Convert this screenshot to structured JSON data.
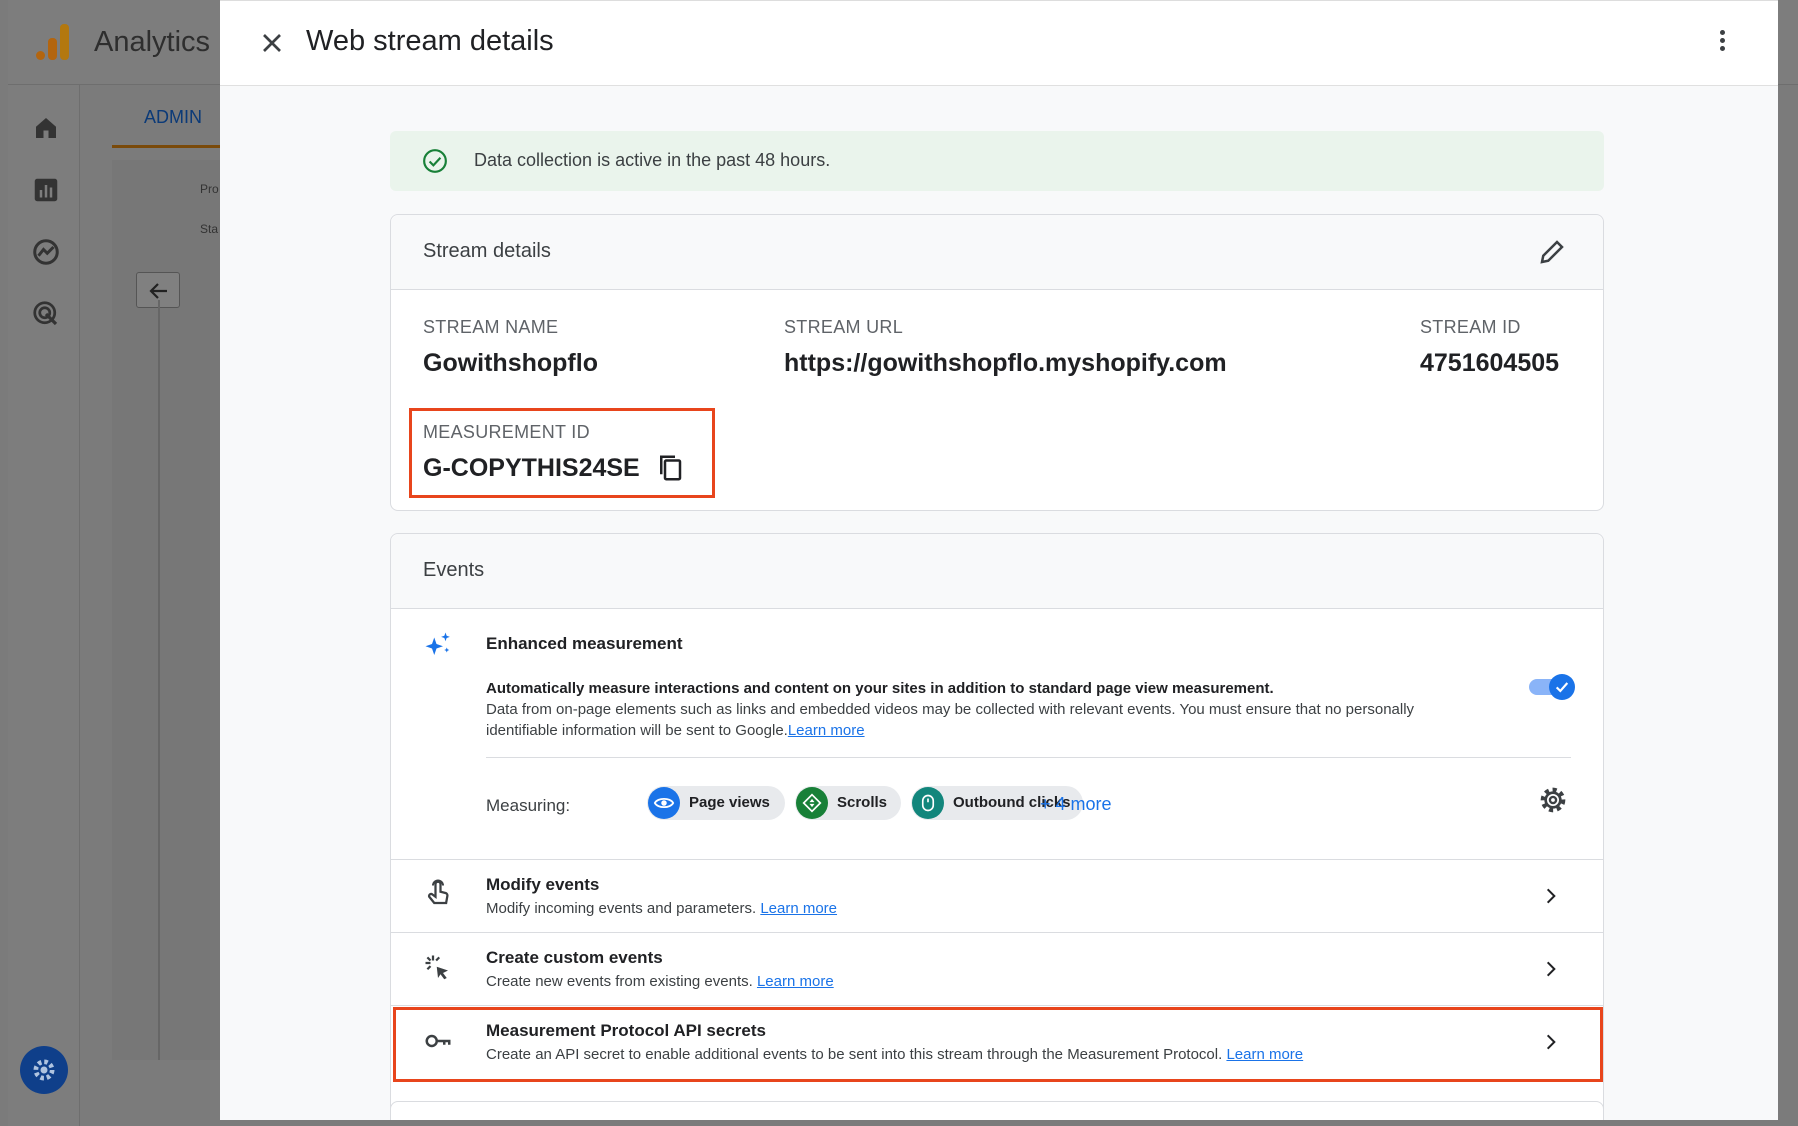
{
  "app": {
    "title": "Analytics",
    "admin_tab": "ADMIN",
    "partial_label_1": "Pro",
    "partial_label_2": "Sta"
  },
  "dialog": {
    "title": "Web stream details"
  },
  "banner": {
    "text": "Data collection is active in the past 48 hours."
  },
  "stream_details": {
    "heading": "Stream details",
    "stream_name_label": "STREAM NAME",
    "stream_name": "Gowithshopflo",
    "stream_url_label": "STREAM URL",
    "stream_url": "https://gowithshopflo.myshopify.com",
    "stream_id_label": "STREAM ID",
    "stream_id": "4751604505",
    "measurement_id_label": "MEASUREMENT ID",
    "measurement_id": "G-COPYTHIS24SE"
  },
  "events": {
    "heading": "Events",
    "enhanced": {
      "title": "Enhanced measurement",
      "desc_line1": "Automatically measure interactions and content on your sites in addition to standard page view measurement.",
      "desc_line2": "Data from on-page elements such as links and embedded videos may be collected with relevant events. You must ensure that no personally identifiable information will be sent to Google.",
      "learn_more": "Learn more",
      "enabled": true
    },
    "measuring_label": "Measuring:",
    "chips": [
      {
        "label": "Page views",
        "color": "#1a73e8"
      },
      {
        "label": "Scrolls",
        "color": "#188038"
      },
      {
        "label": "Outbound clicks",
        "color": "#12867c"
      }
    ],
    "more": "+ 4 more",
    "rows": [
      {
        "title": "Modify events",
        "desc": "Modify incoming events and parameters.",
        "link": "Learn more"
      },
      {
        "title": "Create custom events",
        "desc": "Create new events from existing events.",
        "link": "Learn more"
      },
      {
        "title": "Measurement Protocol API secrets",
        "desc": "Create an API secret to enable additional events to be sent into this stream through the Measurement Protocol.",
        "link": "Learn more"
      }
    ]
  },
  "colors": {
    "accent": "#1a73e8",
    "highlight": "#e8451c",
    "success": "#188038"
  }
}
